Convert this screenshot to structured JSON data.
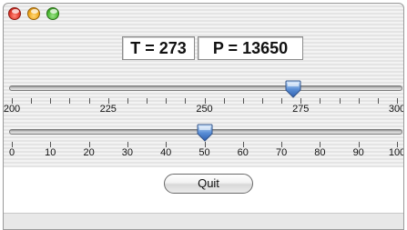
{
  "window": {
    "controls": [
      "close-button",
      "minimize-button",
      "zoom-button"
    ]
  },
  "readouts": {
    "temperature": "T = 273",
    "pressure": "P = 13650"
  },
  "sliders": [
    {
      "name": "temperature-slider",
      "min": 200,
      "max": 300,
      "value": 273,
      "labels": [
        "200",
        "225",
        "250",
        "275",
        "300"
      ],
      "label_values": [
        200,
        225,
        250,
        275,
        300
      ],
      "minor_step": 5,
      "accent": "#5b8fd6"
    },
    {
      "name": "percent-slider",
      "min": 0,
      "max": 100,
      "value": 50,
      "labels": [
        "0",
        "10",
        "20",
        "30",
        "40",
        "50",
        "60",
        "70",
        "80",
        "90",
        "100"
      ],
      "label_values": [
        0,
        10,
        20,
        30,
        40,
        50,
        60,
        70,
        80,
        90,
        100
      ],
      "minor_step": 10,
      "accent": "#5b8fd6"
    }
  ],
  "buttons": {
    "quit": "Quit"
  }
}
